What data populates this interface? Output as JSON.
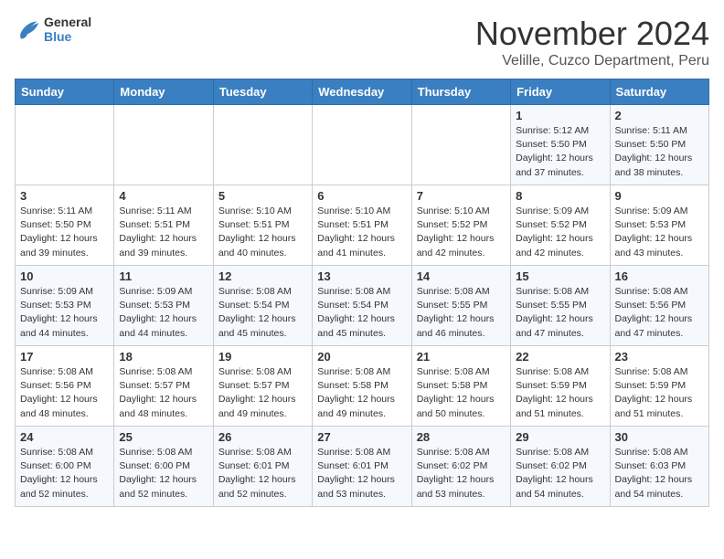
{
  "header": {
    "logo_general": "General",
    "logo_blue": "Blue",
    "month_title": "November 2024",
    "subtitle": "Velille, Cuzco Department, Peru"
  },
  "days_of_week": [
    "Sunday",
    "Monday",
    "Tuesday",
    "Wednesday",
    "Thursday",
    "Friday",
    "Saturday"
  ],
  "weeks": [
    [
      {
        "day": "",
        "info": ""
      },
      {
        "day": "",
        "info": ""
      },
      {
        "day": "",
        "info": ""
      },
      {
        "day": "",
        "info": ""
      },
      {
        "day": "",
        "info": ""
      },
      {
        "day": "1",
        "info": "Sunrise: 5:12 AM\nSunset: 5:50 PM\nDaylight: 12 hours\nand 37 minutes."
      },
      {
        "day": "2",
        "info": "Sunrise: 5:11 AM\nSunset: 5:50 PM\nDaylight: 12 hours\nand 38 minutes."
      }
    ],
    [
      {
        "day": "3",
        "info": "Sunrise: 5:11 AM\nSunset: 5:50 PM\nDaylight: 12 hours\nand 39 minutes."
      },
      {
        "day": "4",
        "info": "Sunrise: 5:11 AM\nSunset: 5:51 PM\nDaylight: 12 hours\nand 39 minutes."
      },
      {
        "day": "5",
        "info": "Sunrise: 5:10 AM\nSunset: 5:51 PM\nDaylight: 12 hours\nand 40 minutes."
      },
      {
        "day": "6",
        "info": "Sunrise: 5:10 AM\nSunset: 5:51 PM\nDaylight: 12 hours\nand 41 minutes."
      },
      {
        "day": "7",
        "info": "Sunrise: 5:10 AM\nSunset: 5:52 PM\nDaylight: 12 hours\nand 42 minutes."
      },
      {
        "day": "8",
        "info": "Sunrise: 5:09 AM\nSunset: 5:52 PM\nDaylight: 12 hours\nand 42 minutes."
      },
      {
        "day": "9",
        "info": "Sunrise: 5:09 AM\nSunset: 5:53 PM\nDaylight: 12 hours\nand 43 minutes."
      }
    ],
    [
      {
        "day": "10",
        "info": "Sunrise: 5:09 AM\nSunset: 5:53 PM\nDaylight: 12 hours\nand 44 minutes."
      },
      {
        "day": "11",
        "info": "Sunrise: 5:09 AM\nSunset: 5:53 PM\nDaylight: 12 hours\nand 44 minutes."
      },
      {
        "day": "12",
        "info": "Sunrise: 5:08 AM\nSunset: 5:54 PM\nDaylight: 12 hours\nand 45 minutes."
      },
      {
        "day": "13",
        "info": "Sunrise: 5:08 AM\nSunset: 5:54 PM\nDaylight: 12 hours\nand 45 minutes."
      },
      {
        "day": "14",
        "info": "Sunrise: 5:08 AM\nSunset: 5:55 PM\nDaylight: 12 hours\nand 46 minutes."
      },
      {
        "day": "15",
        "info": "Sunrise: 5:08 AM\nSunset: 5:55 PM\nDaylight: 12 hours\nand 47 minutes."
      },
      {
        "day": "16",
        "info": "Sunrise: 5:08 AM\nSunset: 5:56 PM\nDaylight: 12 hours\nand 47 minutes."
      }
    ],
    [
      {
        "day": "17",
        "info": "Sunrise: 5:08 AM\nSunset: 5:56 PM\nDaylight: 12 hours\nand 48 minutes."
      },
      {
        "day": "18",
        "info": "Sunrise: 5:08 AM\nSunset: 5:57 PM\nDaylight: 12 hours\nand 48 minutes."
      },
      {
        "day": "19",
        "info": "Sunrise: 5:08 AM\nSunset: 5:57 PM\nDaylight: 12 hours\nand 49 minutes."
      },
      {
        "day": "20",
        "info": "Sunrise: 5:08 AM\nSunset: 5:58 PM\nDaylight: 12 hours\nand 49 minutes."
      },
      {
        "day": "21",
        "info": "Sunrise: 5:08 AM\nSunset: 5:58 PM\nDaylight: 12 hours\nand 50 minutes."
      },
      {
        "day": "22",
        "info": "Sunrise: 5:08 AM\nSunset: 5:59 PM\nDaylight: 12 hours\nand 51 minutes."
      },
      {
        "day": "23",
        "info": "Sunrise: 5:08 AM\nSunset: 5:59 PM\nDaylight: 12 hours\nand 51 minutes."
      }
    ],
    [
      {
        "day": "24",
        "info": "Sunrise: 5:08 AM\nSunset: 6:00 PM\nDaylight: 12 hours\nand 52 minutes."
      },
      {
        "day": "25",
        "info": "Sunrise: 5:08 AM\nSunset: 6:00 PM\nDaylight: 12 hours\nand 52 minutes."
      },
      {
        "day": "26",
        "info": "Sunrise: 5:08 AM\nSunset: 6:01 PM\nDaylight: 12 hours\nand 52 minutes."
      },
      {
        "day": "27",
        "info": "Sunrise: 5:08 AM\nSunset: 6:01 PM\nDaylight: 12 hours\nand 53 minutes."
      },
      {
        "day": "28",
        "info": "Sunrise: 5:08 AM\nSunset: 6:02 PM\nDaylight: 12 hours\nand 53 minutes."
      },
      {
        "day": "29",
        "info": "Sunrise: 5:08 AM\nSunset: 6:02 PM\nDaylight: 12 hours\nand 54 minutes."
      },
      {
        "day": "30",
        "info": "Sunrise: 5:08 AM\nSunset: 6:03 PM\nDaylight: 12 hours\nand 54 minutes."
      }
    ]
  ]
}
